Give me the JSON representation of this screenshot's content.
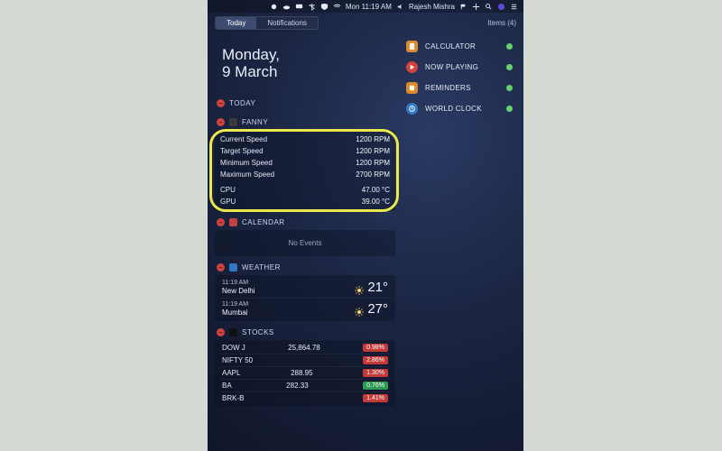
{
  "menubar": {
    "time": "Mon 11:19 AM",
    "user": "Rajesh Mishra"
  },
  "tabs": {
    "today": "Today",
    "notifications": "Notifications",
    "items_label": "Items (4)"
  },
  "date": {
    "line1": "Monday,",
    "line2": "9 March"
  },
  "sections": {
    "today": "TODAY",
    "fanny": "FANNY",
    "calendar": "CALENDAR",
    "weather": "WEATHER",
    "stocks": "STOCKS"
  },
  "fanny": {
    "rows": [
      {
        "k": "Current Speed",
        "v": "1200 RPM"
      },
      {
        "k": "Target Speed",
        "v": "1200 RPM"
      },
      {
        "k": "Minimum Speed",
        "v": "1200 RPM"
      },
      {
        "k": "Maximum Speed",
        "v": "2700 RPM"
      },
      {
        "k": "CPU",
        "v": "47.00 °C"
      },
      {
        "k": "GPU",
        "v": "39.00 °C"
      }
    ]
  },
  "calendar": {
    "no_events": "No Events"
  },
  "weather": {
    "rows": [
      {
        "time": "11:19 AM",
        "city": "New Delhi",
        "temp": "21°"
      },
      {
        "time": "11:19 AM",
        "city": "Mumbai",
        "temp": "27°"
      }
    ]
  },
  "stocks": {
    "rows": [
      {
        "sym": "DOW J",
        "val": "25,864.78",
        "chg": "0.98%",
        "dir": "neg"
      },
      {
        "sym": "NIFTY 50",
        "val": "",
        "chg": "2.86%",
        "dir": "neg"
      },
      {
        "sym": "AAPL",
        "val": "288.95",
        "chg": "1.30%",
        "dir": "neg"
      },
      {
        "sym": "BA",
        "val": "282.33",
        "chg": "0.76%",
        "dir": "pos"
      },
      {
        "sym": "BRK-B",
        "val": "",
        "chg": "1.41%",
        "dir": "neg"
      }
    ]
  },
  "right_widgets": [
    {
      "name": "CALCULATOR",
      "color": "#d98b2e"
    },
    {
      "name": "NOW PLAYING",
      "color": "#d2413d"
    },
    {
      "name": "REMINDERS",
      "color": "#d98b2e"
    },
    {
      "name": "WORLD CLOCK",
      "color": "#2f79c6"
    }
  ]
}
